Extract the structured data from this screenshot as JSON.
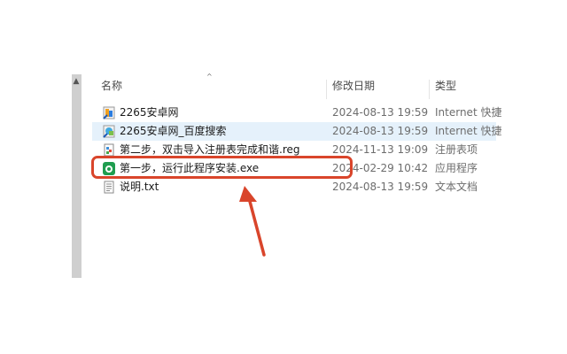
{
  "columns": {
    "name": "名称",
    "date": "修改日期",
    "type": "类型"
  },
  "files": [
    {
      "icon": "internet-shortcut-icon",
      "name": "2265安卓网",
      "date": "2024-08-13 19:59",
      "type": "Internet 快捷"
    },
    {
      "icon": "internet-shortcut-icon",
      "name": "2265安卓网_百度搜索",
      "date": "2024-08-13 19:59",
      "type": "Internet 快捷"
    },
    {
      "icon": "registry-file-icon",
      "name": "第二步，双击导入注册表完成和谐.reg",
      "date": "2024-11-13 19:09",
      "type": "注册表项"
    },
    {
      "icon": "app-installer-icon",
      "name": "第一步，运行此程序安装.exe",
      "date": "2024-02-29 10:42",
      "type": "应用程序"
    },
    {
      "icon": "text-document-icon",
      "name": "说明.txt",
      "date": "2024-08-13 19:59",
      "type": "文本文档"
    }
  ],
  "selected_row": 1,
  "highlighted_row": 3,
  "colors": {
    "highlight": "#d9452b",
    "selection": "#e5f1fb"
  }
}
